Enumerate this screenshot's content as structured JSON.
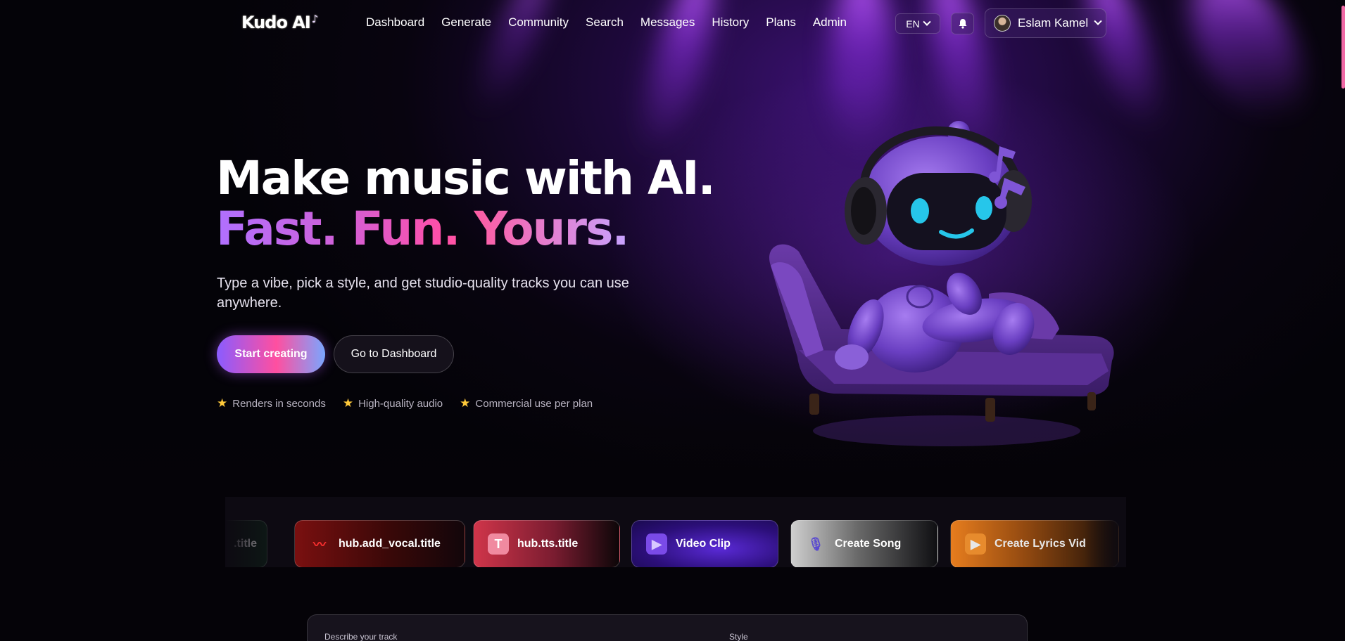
{
  "nav": {
    "logo": "Kudo AI",
    "links": [
      "Dashboard",
      "Generate",
      "Community",
      "Search",
      "Messages",
      "History",
      "Plans",
      "Admin"
    ],
    "language": "EN",
    "user_name": "Eslam Kamel"
  },
  "hero": {
    "title": "Make music with AI.",
    "subtitle": "Fast. Fun. Yours.",
    "description": "Type a vibe, pick a style, and get studio-quality tracks you can use anywhere.",
    "primary_button": "Start creating",
    "secondary_button": "Go to Dashboard",
    "features": [
      "Renders in seconds",
      "High-quality audio",
      "Commercial use per plan"
    ]
  },
  "hub_cards": [
    {
      "label": ".title",
      "icon": "partial-card-icon"
    },
    {
      "label": "hub.add_vocal.title",
      "icon": "waveform-icon"
    },
    {
      "label": "hub.tts.title",
      "icon": "text-to-speech-icon"
    },
    {
      "label": "Video Clip",
      "icon": "video-clip-icon"
    },
    {
      "label": "Create Song",
      "icon": "microphone-icon"
    },
    {
      "label": "Create Lyrics Vid",
      "icon": "lyrics-video-icon"
    }
  ],
  "composer": {
    "describe_label": "Describe your track",
    "style_label": "Style"
  },
  "colors": {
    "accent_purple": "#8a5cff",
    "accent_pink": "#ff4fa0",
    "star": "#ffc93a"
  }
}
